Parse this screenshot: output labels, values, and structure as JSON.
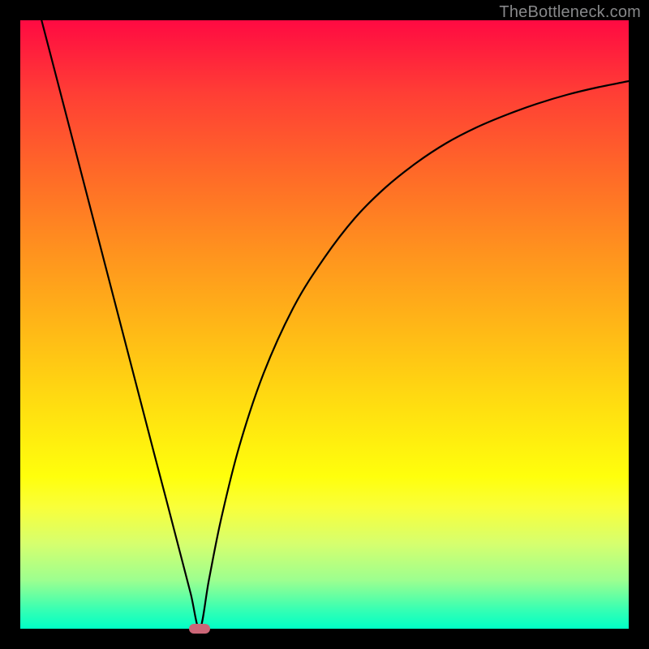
{
  "watermark": "TheBottleneck.com",
  "colors": {
    "curve_stroke": "#000000",
    "marker_fill": "#cc6677",
    "frame_bg": "#000000"
  },
  "chart_data": {
    "type": "line",
    "title": "",
    "xlabel": "",
    "ylabel": "",
    "xlim": [
      0,
      100
    ],
    "ylim": [
      0,
      100
    ],
    "grid": false,
    "legend": false,
    "gradient_stops": [
      {
        "pos": 0,
        "color": "#ff0a42"
      },
      {
        "pos": 12,
        "color": "#ff3e35"
      },
      {
        "pos": 25,
        "color": "#ff6928"
      },
      {
        "pos": 37,
        "color": "#ff8f1f"
      },
      {
        "pos": 50,
        "color": "#ffb617"
      },
      {
        "pos": 62,
        "color": "#ffda11"
      },
      {
        "pos": 75,
        "color": "#ffff0c"
      },
      {
        "pos": 80,
        "color": "#f9ff3a"
      },
      {
        "pos": 86,
        "color": "#d6ff6e"
      },
      {
        "pos": 92,
        "color": "#9dff8f"
      },
      {
        "pos": 97,
        "color": "#34ffb4"
      },
      {
        "pos": 100,
        "color": "#00ffc6"
      }
    ],
    "series": [
      {
        "name": "left-branch",
        "x": [
          3.5,
          6,
          8,
          10,
          12,
          14,
          16,
          18,
          20,
          22,
          24,
          26,
          28,
          29.5
        ],
        "y": [
          100,
          90.4,
          82.7,
          75.0,
          67.3,
          59.6,
          51.9,
          44.2,
          36.5,
          28.8,
          21.2,
          13.5,
          5.8,
          0
        ]
      },
      {
        "name": "right-branch",
        "x": [
          29.5,
          31,
          33,
          36,
          40,
          45,
          50,
          55,
          60,
          65,
          70,
          75,
          80,
          85,
          90,
          95,
          100
        ],
        "y": [
          0,
          8,
          18,
          30,
          42,
          53,
          61,
          67.5,
          72.5,
          76.5,
          79.8,
          82.4,
          84.5,
          86.3,
          87.8,
          89.0,
          90.0
        ]
      }
    ],
    "minimum_marker": {
      "x": 29.5,
      "y": 0
    }
  }
}
